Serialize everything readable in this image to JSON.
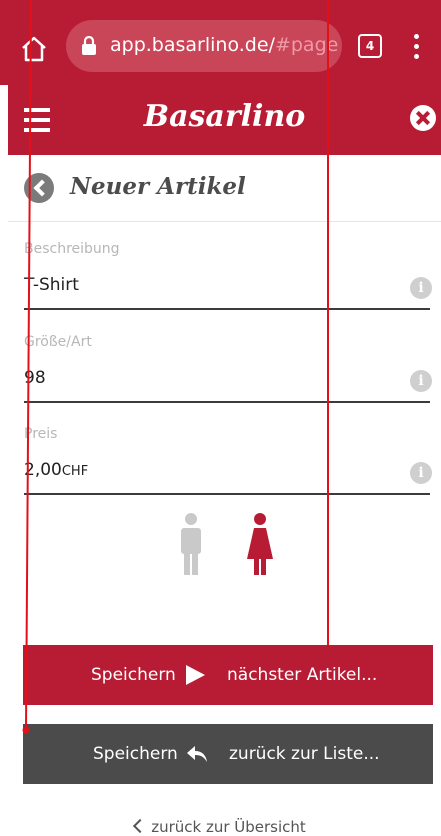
{
  "browser": {
    "url_host": "app.basarlino.de/",
    "url_path": "#page",
    "tab_count": "4"
  },
  "app": {
    "logo": "Basarlino"
  },
  "page": {
    "title": "Neuer Artikel"
  },
  "form": {
    "fields": [
      {
        "label": "Beschreibung",
        "value": "T-Shirt"
      },
      {
        "label": "Größe/Art",
        "value": "98"
      },
      {
        "label": "Preis",
        "value": "2,00",
        "currency": "CHF"
      }
    ],
    "gender_options": [
      {
        "name": "male",
        "color": "#c9c9c9",
        "selected": false
      },
      {
        "name": "female",
        "color": "#b81c34",
        "selected": true
      }
    ]
  },
  "buttons": {
    "save_next": {
      "label_left": "Speichern",
      "label_right": "nächster Artikel...",
      "icon": "play-icon"
    },
    "save_back": {
      "label_left": "Speichern",
      "label_right": "zurück zur Liste...",
      "icon": "reply-arrow-icon"
    }
  },
  "footer": {
    "back_overview": "zurück zur Übersicht"
  },
  "colors": {
    "brand": "#b81c34",
    "dark_button": "#4b4b4b",
    "annotation_line": "#e3101a"
  }
}
